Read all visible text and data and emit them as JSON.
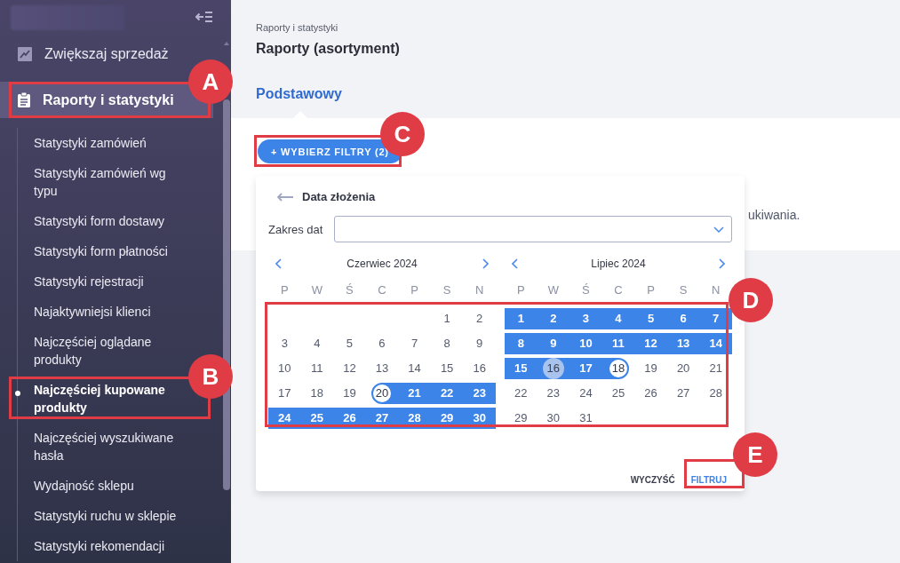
{
  "sidebar": {
    "menu": [
      {
        "label": "Zwiększaj sprzedaż",
        "kind": "chart",
        "selected": false
      },
      {
        "label": "Raporty i statystyki",
        "kind": "clipboard",
        "selected": true
      }
    ],
    "items": [
      {
        "label": "Statystyki zamówień",
        "selected": false
      },
      {
        "label": "Statystyki zamówień wg typu",
        "selected": false
      },
      {
        "label": "Statystyki form dostawy",
        "selected": false
      },
      {
        "label": "Statystyki form płatności",
        "selected": false
      },
      {
        "label": "Statystyki rejestracji",
        "selected": false
      },
      {
        "label": "Najaktywniejsi klienci",
        "selected": false
      },
      {
        "label": "Najczęściej oglądane produkty",
        "selected": false
      },
      {
        "label": "Najczęściej kupowane produkty",
        "selected": true
      },
      {
        "label": "Najczęściej wyszukiwane hasła",
        "selected": false
      },
      {
        "label": "Wydajność sklepu",
        "selected": false
      },
      {
        "label": "Statystyki ruchu w sklepie",
        "selected": false
      },
      {
        "label": "Statystyki rekomendacji",
        "selected": false
      }
    ]
  },
  "breadcrumb": "Raporty i statystyki",
  "title": "Raporty (asortyment)",
  "tab": {
    "label": "Podstawowy",
    "selected": true
  },
  "filter_button": "+ WYBIERZ FILTRY (2)",
  "background_text": "ukiwania.",
  "popup": {
    "title": "Data złożenia",
    "field_label": "Zakres dat",
    "months": [
      {
        "name": "Czerwiec 2024",
        "weekdays": [
          "P",
          "W",
          "Ś",
          "C",
          "P",
          "S",
          "N"
        ],
        "weeks": [
          [
            {
              "kind": "blank"
            },
            {
              "kind": "blank"
            },
            {
              "kind": "blank"
            },
            {
              "kind": "blank"
            },
            {
              "kind": "blank"
            },
            {
              "day": "1",
              "kind": "day"
            },
            {
              "day": "2",
              "kind": "day"
            }
          ],
          [
            {
              "day": "3",
              "kind": "day"
            },
            {
              "day": "4",
              "kind": "day"
            },
            {
              "day": "5",
              "kind": "day"
            },
            {
              "day": "6",
              "kind": "day"
            },
            {
              "day": "7",
              "kind": "day"
            },
            {
              "day": "8",
              "kind": "day"
            },
            {
              "day": "9",
              "kind": "day"
            }
          ],
          [
            {
              "day": "10",
              "kind": "day"
            },
            {
              "day": "11",
              "kind": "day"
            },
            {
              "day": "12",
              "kind": "day"
            },
            {
              "day": "13",
              "kind": "day"
            },
            {
              "day": "14",
              "kind": "day"
            },
            {
              "day": "15",
              "kind": "day"
            },
            {
              "day": "16",
              "kind": "day"
            }
          ],
          [
            {
              "day": "17",
              "kind": "day"
            },
            {
              "day": "18",
              "kind": "day"
            },
            {
              "day": "19",
              "kind": "day"
            },
            {
              "day": "20",
              "kind": "start"
            },
            {
              "day": "21",
              "kind": "range"
            },
            {
              "day": "22",
              "kind": "range"
            },
            {
              "day": "23",
              "kind": "range"
            }
          ],
          [
            {
              "day": "24",
              "kind": "range"
            },
            {
              "day": "25",
              "kind": "range"
            },
            {
              "day": "26",
              "kind": "range"
            },
            {
              "day": "27",
              "kind": "range"
            },
            {
              "day": "28",
              "kind": "range"
            },
            {
              "day": "29",
              "kind": "range"
            },
            {
              "day": "30",
              "kind": "range"
            }
          ]
        ]
      },
      {
        "name": "Lipiec 2024",
        "weekdays": [
          "P",
          "W",
          "Ś",
          "C",
          "P",
          "S",
          "N"
        ],
        "weeks": [
          [
            {
              "day": "1",
              "kind": "range"
            },
            {
              "day": "2",
              "kind": "range"
            },
            {
              "day": "3",
              "kind": "range"
            },
            {
              "day": "4",
              "kind": "range"
            },
            {
              "day": "5",
              "kind": "range"
            },
            {
              "day": "6",
              "kind": "range"
            },
            {
              "day": "7",
              "kind": "range"
            }
          ],
          [
            {
              "day": "8",
              "kind": "range"
            },
            {
              "day": "9",
              "kind": "range"
            },
            {
              "day": "10",
              "kind": "range"
            },
            {
              "day": "11",
              "kind": "range"
            },
            {
              "day": "12",
              "kind": "range"
            },
            {
              "day": "13",
              "kind": "range"
            },
            {
              "day": "14",
              "kind": "range"
            }
          ],
          [
            {
              "day": "15",
              "kind": "range"
            },
            {
              "day": "16",
              "kind": "today"
            },
            {
              "day": "17",
              "kind": "range"
            },
            {
              "day": "18",
              "kind": "end"
            },
            {
              "day": "19",
              "kind": "day"
            },
            {
              "day": "20",
              "kind": "day"
            },
            {
              "day": "21",
              "kind": "day"
            }
          ],
          [
            {
              "day": "22",
              "kind": "day"
            },
            {
              "day": "23",
              "kind": "day"
            },
            {
              "day": "24",
              "kind": "day"
            },
            {
              "day": "25",
              "kind": "day"
            },
            {
              "day": "26",
              "kind": "day"
            },
            {
              "day": "27",
              "kind": "day"
            },
            {
              "day": "28",
              "kind": "day"
            }
          ],
          [
            {
              "day": "29",
              "kind": "day"
            },
            {
              "day": "30",
              "kind": "day"
            },
            {
              "day": "31",
              "kind": "day"
            },
            {
              "kind": "blank"
            },
            {
              "kind": "blank"
            },
            {
              "kind": "blank"
            },
            {
              "kind": "blank"
            }
          ]
        ]
      }
    ],
    "clear_button": "WYCZYŚĆ",
    "filter_button": "FILTRUJ"
  },
  "annotations": [
    {
      "label": "A"
    },
    {
      "label": "B"
    },
    {
      "label": "C"
    },
    {
      "label": "D"
    },
    {
      "label": "E"
    }
  ]
}
